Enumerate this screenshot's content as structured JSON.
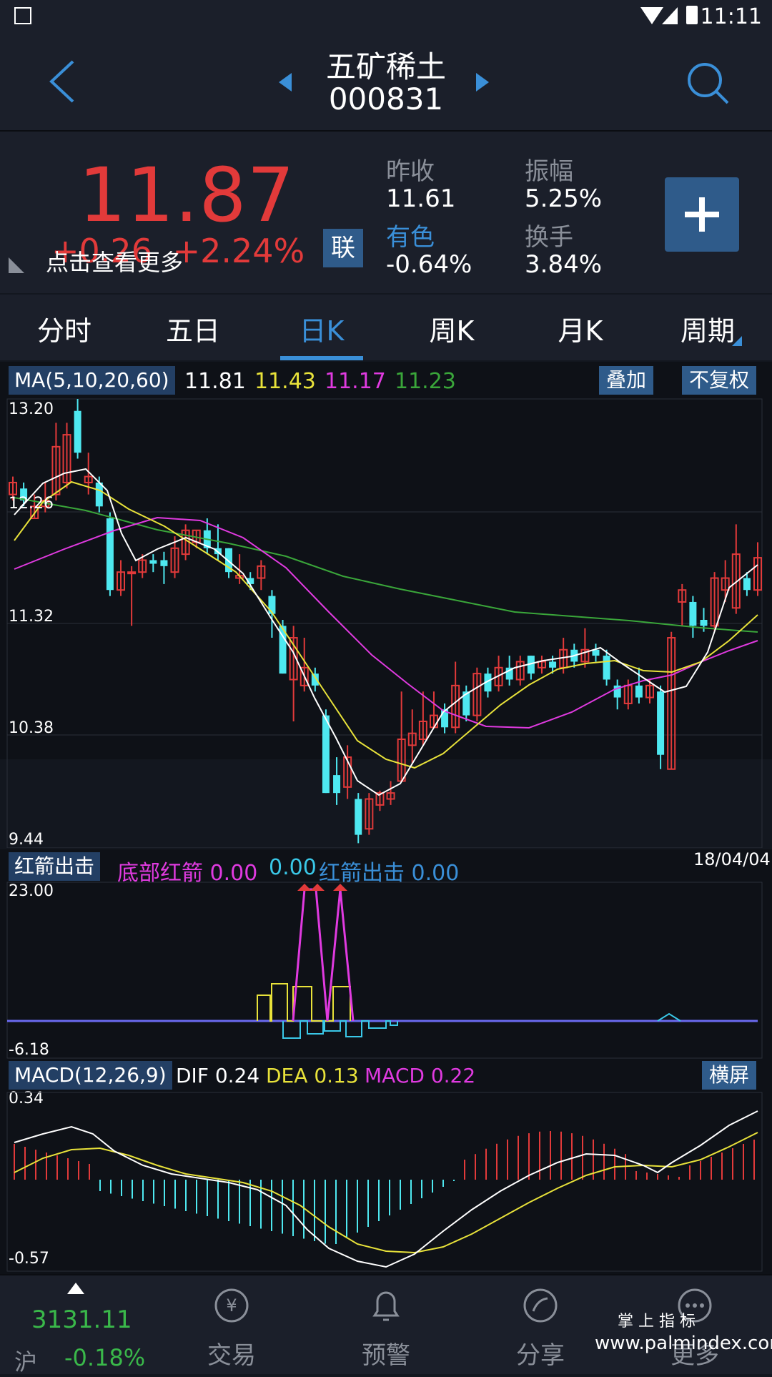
{
  "status_bar": {
    "time": "11:11"
  },
  "header": {
    "title": "五矿稀土",
    "code": "000831"
  },
  "quote": {
    "price": "11.87",
    "change": "+0.26",
    "change_pct": "+2.24%",
    "more_tip": "点击查看更多",
    "lian_label": "联",
    "prev_close_label": "昨收",
    "prev_close": "11.61",
    "amplitude_label": "振幅",
    "amplitude": "5.25%",
    "sector_label": "有色",
    "sector_change": "-0.64%",
    "turnover_label": "换手",
    "turnover": "3.84%"
  },
  "tabs": [
    "分时",
    "五日",
    "日K",
    "周K",
    "月K",
    "周期"
  ],
  "active_tab": "日K",
  "ma_panel": {
    "label": "MA(5,10,20,60)",
    "ma5": "11.81",
    "ma10": "11.43",
    "ma20": "11.17",
    "ma60": "11.23",
    "overlay_btn": "叠加",
    "adjust_btn": "不复权",
    "ticks": [
      "13.20",
      "12.26",
      "11.32",
      "10.38",
      "9.44"
    ],
    "date": "18/04/04"
  },
  "arrow_panel": {
    "label": "红箭出击",
    "bottom_label": "底部红箭",
    "bottom_value": "0.00",
    "value2": "0.00",
    "strike_label": "红箭出击",
    "strike_value": "0.00",
    "top_tick": "23.00",
    "bottom_tick": "-6.18"
  },
  "macd_panel": {
    "label": "MACD(12,26,9)",
    "dif_label": "DIF",
    "dif": "0.24",
    "dea_label": "DEA",
    "dea": "0.13",
    "macd_label": "MACD",
    "macd": "0.22",
    "landscape_btn": "横屏",
    "top_tick": "0.34",
    "bottom_tick": "-0.57"
  },
  "bottom_nav": {
    "index_value": "3131.11",
    "index_name": "沪",
    "index_change": "-0.18%",
    "items": [
      "交易",
      "预警",
      "分享",
      "更多"
    ]
  },
  "watermark": {
    "brand": "掌 上 指 标",
    "url": "www.palmindex.com"
  },
  "colors": {
    "up": "#e23a3a",
    "down": "#4ee8f0",
    "ma5": "#ffffff",
    "ma10": "#e8e23a",
    "ma20": "#e03ae0",
    "ma60": "#3aa63a",
    "accent": "#3a8fd8"
  },
  "chart_data": {
    "type": "candlestick",
    "y_range": [
      9.44,
      13.2
    ],
    "candles": [
      {
        "o": 12.4,
        "c": 12.5,
        "h": 12.55,
        "l": 12.35
      },
      {
        "o": 12.45,
        "c": 12.35,
        "h": 12.5,
        "l": 12.3
      },
      {
        "o": 12.2,
        "c": 12.3,
        "h": 12.4,
        "l": 12.2
      },
      {
        "o": 12.3,
        "c": 12.35,
        "h": 12.5,
        "l": 12.25
      },
      {
        "o": 12.4,
        "c": 12.8,
        "h": 13.0,
        "l": 12.35
      },
      {
        "o": 12.5,
        "c": 12.9,
        "h": 13.0,
        "l": 12.45
      },
      {
        "o": 13.1,
        "c": 12.75,
        "h": 13.2,
        "l": 12.7
      },
      {
        "o": 12.5,
        "c": 12.55,
        "h": 12.75,
        "l": 12.4
      },
      {
        "o": 12.5,
        "c": 12.3,
        "h": 12.55,
        "l": 12.25
      },
      {
        "o": 12.2,
        "c": 11.6,
        "h": 12.25,
        "l": 11.55
      },
      {
        "o": 11.6,
        "c": 11.75,
        "h": 11.85,
        "l": 11.55
      },
      {
        "o": 11.75,
        "c": 11.75,
        "h": 11.8,
        "l": 11.3
      },
      {
        "o": 11.75,
        "c": 11.85,
        "h": 11.9,
        "l": 11.7
      },
      {
        "o": 11.85,
        "c": 11.82,
        "h": 11.9,
        "l": 11.75
      },
      {
        "o": 11.85,
        "c": 11.8,
        "h": 11.92,
        "l": 11.65
      },
      {
        "o": 11.75,
        "c": 11.95,
        "h": 12.05,
        "l": 11.7
      },
      {
        "o": 11.9,
        "c": 12.1,
        "h": 12.15,
        "l": 11.85
      },
      {
        "o": 12.0,
        "c": 12.1,
        "h": 12.1,
        "l": 11.95
      },
      {
        "o": 12.1,
        "c": 11.95,
        "h": 12.2,
        "l": 11.9
      },
      {
        "o": 11.95,
        "c": 11.9,
        "h": 12.15,
        "l": 11.85
      },
      {
        "o": 11.95,
        "c": 11.75,
        "h": 11.95,
        "l": 11.7
      },
      {
        "o": 11.7,
        "c": 11.72,
        "h": 11.9,
        "l": 11.65
      },
      {
        "o": 11.7,
        "c": 11.65,
        "h": 11.75,
        "l": 11.6
      },
      {
        "o": 11.7,
        "c": 11.8,
        "h": 11.85,
        "l": 11.6
      },
      {
        "o": 11.55,
        "c": 11.4,
        "h": 11.6,
        "l": 11.2
      },
      {
        "o": 11.3,
        "c": 10.9,
        "h": 11.35,
        "l": 10.9
      },
      {
        "o": 10.85,
        "c": 11.2,
        "h": 11.3,
        "l": 10.5
      },
      {
        "o": 10.8,
        "c": 10.95,
        "h": 11.2,
        "l": 10.75
      },
      {
        "o": 10.9,
        "c": 10.8,
        "h": 10.95,
        "l": 10.75
      },
      {
        "o": 10.55,
        "c": 9.9,
        "h": 10.6,
        "l": 9.9
      },
      {
        "o": 10.05,
        "c": 9.9,
        "h": 10.2,
        "l": 9.8
      },
      {
        "o": 9.95,
        "c": 10.2,
        "h": 10.3,
        "l": 9.85
      },
      {
        "o": 9.85,
        "c": 9.55,
        "h": 9.9,
        "l": 9.48
      },
      {
        "o": 9.6,
        "c": 9.85,
        "h": 9.9,
        "l": 9.55
      },
      {
        "o": 9.8,
        "c": 9.9,
        "h": 9.92,
        "l": 9.75
      },
      {
        "o": 9.85,
        "c": 9.9,
        "h": 10.0,
        "l": 9.8
      },
      {
        "o": 10.0,
        "c": 10.35,
        "h": 10.75,
        "l": 10.0
      },
      {
        "o": 10.3,
        "c": 10.4,
        "h": 10.6,
        "l": 10.15
      },
      {
        "o": 10.35,
        "c": 10.5,
        "h": 10.75,
        "l": 10.3
      },
      {
        "o": 10.45,
        "c": 10.55,
        "h": 10.75,
        "l": 10.45
      },
      {
        "o": 10.6,
        "c": 10.45,
        "h": 10.65,
        "l": 10.4
      },
      {
        "o": 10.45,
        "c": 10.8,
        "h": 11.0,
        "l": 10.4
      },
      {
        "o": 10.75,
        "c": 10.55,
        "h": 10.8,
        "l": 10.5
      },
      {
        "o": 10.55,
        "c": 10.9,
        "h": 10.95,
        "l": 10.5
      },
      {
        "o": 10.9,
        "c": 10.75,
        "h": 10.95,
        "l": 10.7
      },
      {
        "o": 10.8,
        "c": 10.95,
        "h": 11.05,
        "l": 10.75
      },
      {
        "o": 10.95,
        "c": 10.85,
        "h": 11.05,
        "l": 10.8
      },
      {
        "o": 10.85,
        "c": 11.0,
        "h": 11.05,
        "l": 10.8
      },
      {
        "o": 11.05,
        "c": 10.9,
        "h": 11.05,
        "l": 10.85
      },
      {
        "o": 10.95,
        "c": 11.0,
        "h": 11.05,
        "l": 10.9
      },
      {
        "o": 11.0,
        "c": 10.95,
        "h": 11.05,
        "l": 10.9
      },
      {
        "o": 10.95,
        "c": 11.1,
        "h": 11.2,
        "l": 10.9
      },
      {
        "o": 11.1,
        "c": 11.0,
        "h": 11.15,
        "l": 10.95
      },
      {
        "o": 11.0,
        "c": 11.1,
        "h": 11.28,
        "l": 10.95
      },
      {
        "o": 11.1,
        "c": 11.05,
        "h": 11.15,
        "l": 11.0
      },
      {
        "o": 11.05,
        "c": 10.85,
        "h": 11.1,
        "l": 10.8
      },
      {
        "o": 10.8,
        "c": 10.7,
        "h": 10.85,
        "l": 10.6
      },
      {
        "o": 10.65,
        "c": 10.8,
        "h": 10.85,
        "l": 10.6
      },
      {
        "o": 10.8,
        "c": 10.7,
        "h": 10.95,
        "l": 10.65
      },
      {
        "o": 10.7,
        "c": 10.8,
        "h": 10.85,
        "l": 10.65
      },
      {
        "o": 10.75,
        "c": 10.22,
        "h": 10.8,
        "l": 10.1
      },
      {
        "o": 10.1,
        "c": 11.2,
        "h": 11.25,
        "l": 10.1
      },
      {
        "o": 11.5,
        "c": 11.6,
        "h": 11.65,
        "l": 11.3
      },
      {
        "o": 11.5,
        "c": 11.3,
        "h": 11.55,
        "l": 11.2
      },
      {
        "o": 11.35,
        "c": 11.3,
        "h": 11.45,
        "l": 11.25
      },
      {
        "o": 11.3,
        "c": 11.7,
        "h": 11.75,
        "l": 11.25
      },
      {
        "o": 11.6,
        "c": 11.7,
        "h": 11.85,
        "l": 11.5
      },
      {
        "o": 11.45,
        "c": 11.9,
        "h": 12.15,
        "l": 11.4
      },
      {
        "o": 11.7,
        "c": 11.6,
        "h": 11.75,
        "l": 11.55
      },
      {
        "o": 11.6,
        "c": 11.87,
        "h": 12.0,
        "l": 11.55
      }
    ]
  }
}
